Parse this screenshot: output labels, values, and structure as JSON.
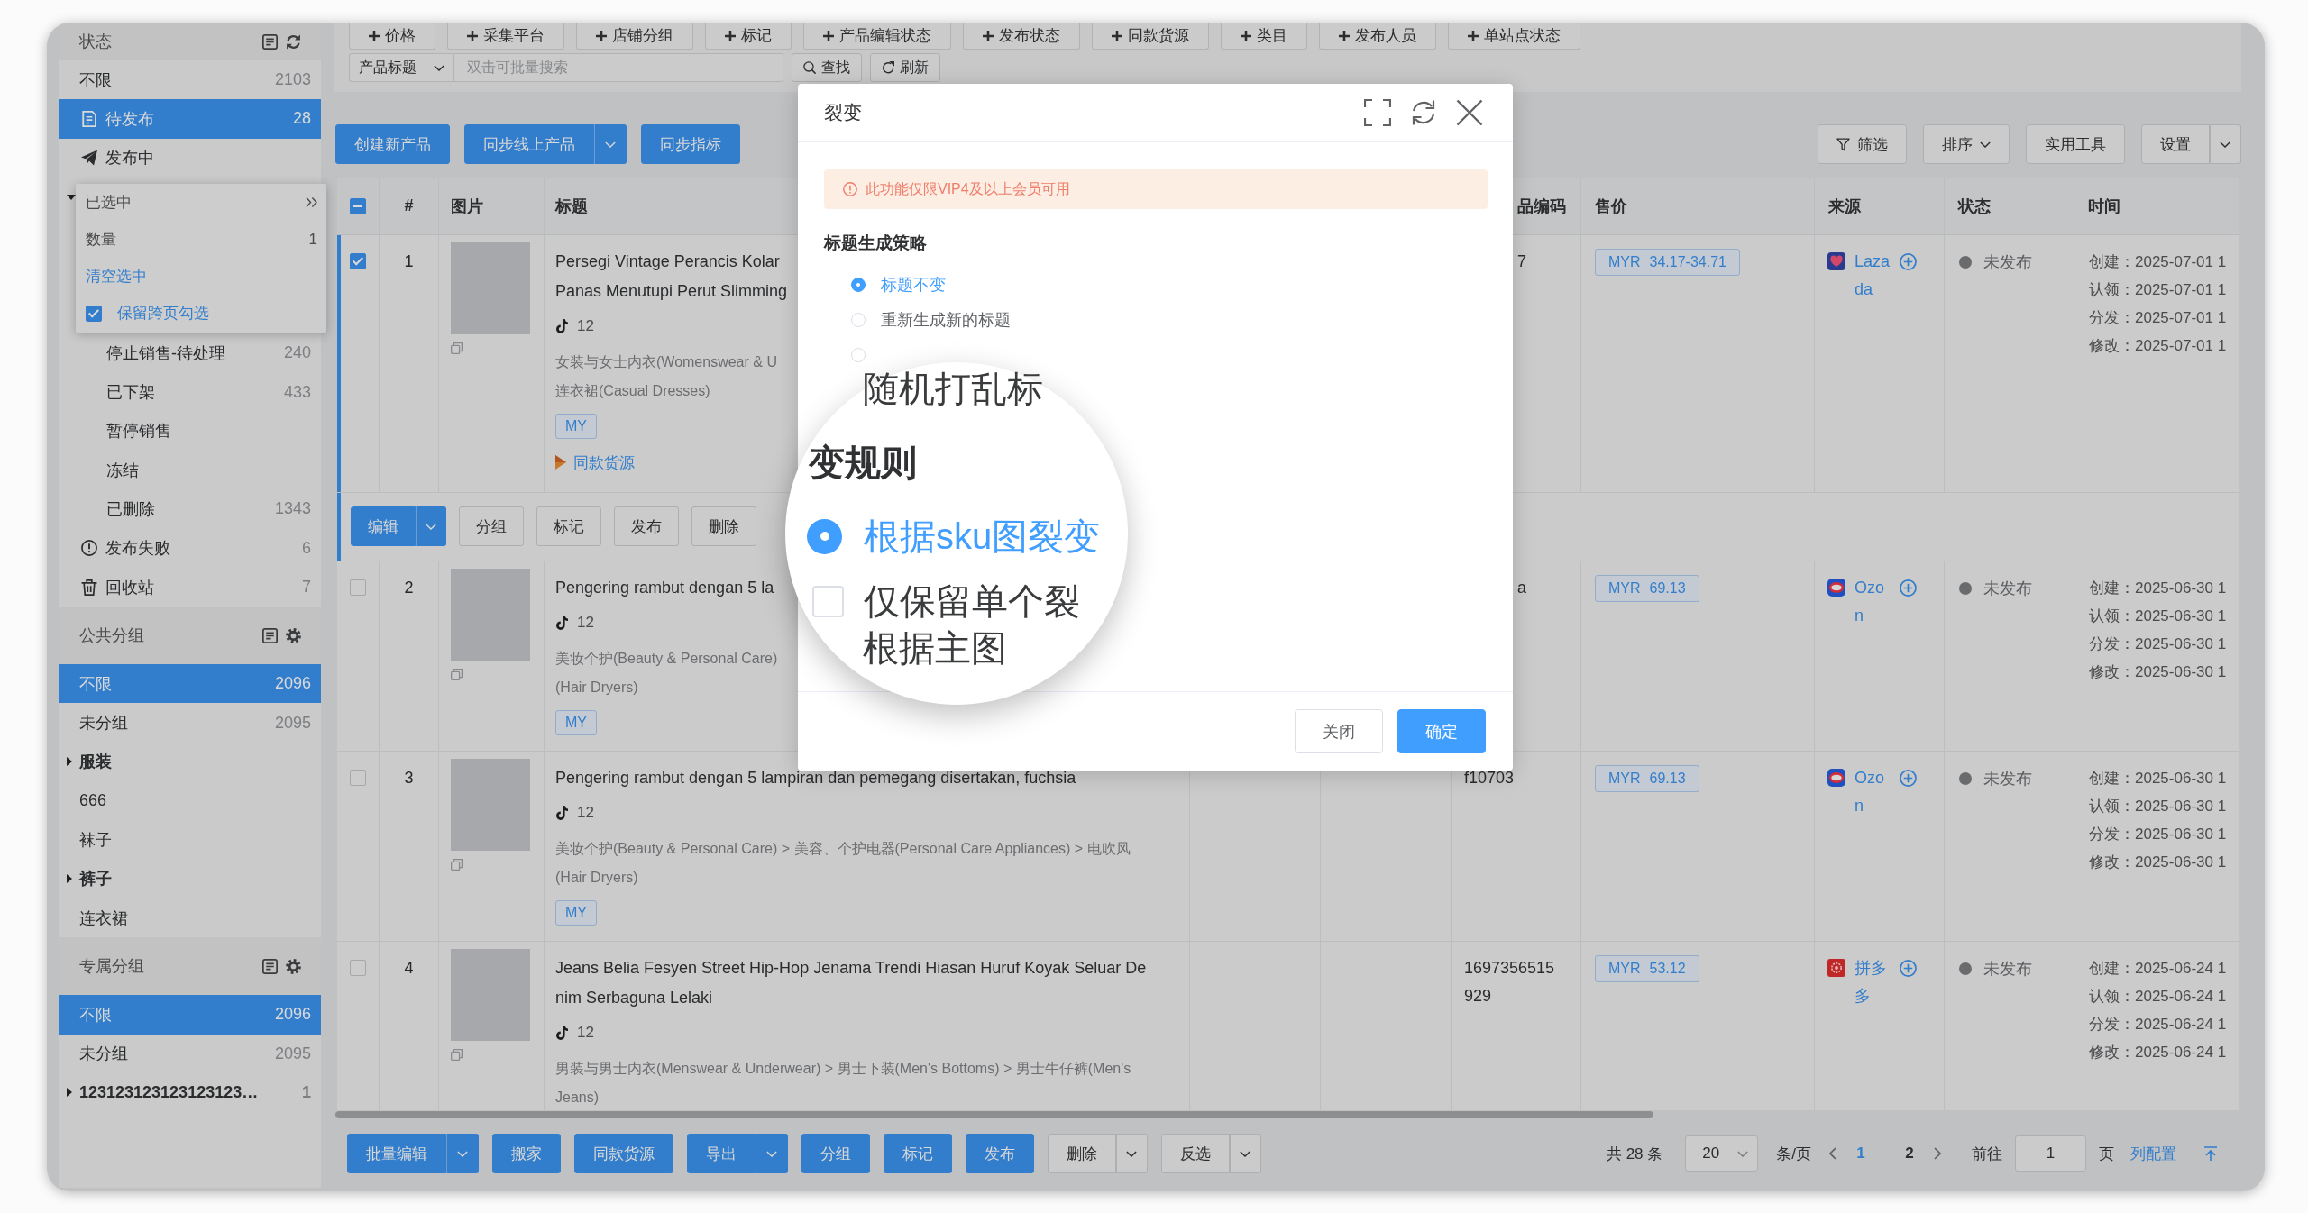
{
  "filters": {
    "tags": [
      "价格",
      "采集平台",
      "店铺分组",
      "标记",
      "产品编辑状态",
      "发布状态",
      "同款货源",
      "类目",
      "发布人员",
      "单站点状态"
    ],
    "search": {
      "field": "产品标题",
      "placeholder": "双击可批量搜索",
      "buttons": [
        {
          "label": "查找",
          "kind": "search"
        },
        {
          "label": "刷新",
          "kind": "refresh"
        }
      ]
    }
  },
  "sidebar": {
    "sections": [
      {
        "title": "状态",
        "kind": "status",
        "items": [
          {
            "label": "不限",
            "count": "2103",
            "selected": false,
            "kind": "plain"
          },
          {
            "label": "待发布",
            "count": "28",
            "selected": true,
            "kind": "draft"
          },
          {
            "label": "发布中",
            "selected": false,
            "kind": "sending"
          },
          {
            "kind": "group",
            "expanded": true,
            "children": [
              {
                "label": "停止销售-待处理",
                "count": "240",
                "selected": false,
                "kind": "plain"
              },
              {
                "label": "已下架",
                "count": "433",
                "selected": false,
                "kind": "plain"
              },
              {
                "label": "暂停销售",
                "selected": false,
                "kind": "plain"
              },
              {
                "label": "冻结",
                "selected": false,
                "kind": "plain"
              },
              {
                "label": "已删除",
                "count": "1343",
                "selected": false,
                "kind": "plain"
              }
            ]
          },
          {
            "label": "发布失败",
            "count": "6",
            "selected": false,
            "kind": "failed"
          },
          {
            "label": "回收站",
            "count": "7",
            "selected": false,
            "kind": "trash"
          }
        ]
      },
      {
        "title": "公共分组",
        "kind": "groups",
        "items": [
          {
            "label": "不限",
            "count": "2096",
            "selected": true,
            "kind": "plain"
          },
          {
            "label": "未分组",
            "count": "2095",
            "selected": false,
            "kind": "plain"
          },
          {
            "label": "服装",
            "selected": false,
            "kind": "folder",
            "expanded": false
          },
          {
            "label": "666",
            "selected": false,
            "kind": "plain"
          },
          {
            "label": "袜子",
            "selected": false,
            "kind": "plain"
          },
          {
            "label": "裤子",
            "selected": false,
            "kind": "folder",
            "expanded": false
          },
          {
            "label": "连衣裙",
            "selected": false,
            "kind": "plain"
          }
        ]
      },
      {
        "title": "专属分组",
        "kind": "groups",
        "items": [
          {
            "label": "不限",
            "count": "2096",
            "selected": true,
            "kind": "plain"
          },
          {
            "label": "未分组",
            "count": "2095",
            "selected": false,
            "kind": "plain"
          },
          {
            "label": "123123123123123123…",
            "count": "1",
            "selected": false,
            "kind": "folder",
            "expanded": false
          }
        ]
      }
    ],
    "selection": {
      "title": "已选中",
      "count_label": "数量",
      "count": "1",
      "clear": "清空选中",
      "keep_label": "保留跨页勾选",
      "keep_checked": true
    }
  },
  "toolbar": {
    "left": [
      {
        "label": "创建新产品",
        "kind": "plain"
      },
      {
        "label": "同步线上产品",
        "kind": "split"
      },
      {
        "label": "同步指标",
        "kind": "plain"
      }
    ],
    "right": [
      {
        "label": "筛选",
        "kind": "filter"
      },
      {
        "label": "排序",
        "kind": "menu"
      },
      {
        "label": "实用工具",
        "kind": "plain"
      },
      {
        "label": "设置",
        "kind": "split"
      }
    ]
  },
  "table": {
    "select_all": {
      "indeterminate": true
    },
    "columns": [
      {
        "label": "#"
      },
      {
        "label": "图片"
      },
      {
        "label": "标题"
      },
      {
        "label": "品编码",
        "covered": true
      },
      {
        "label": "售价"
      },
      {
        "label": "来源"
      },
      {
        "label": "状态"
      },
      {
        "label": "时间"
      }
    ],
    "rows": [
      {
        "checked": true,
        "index": "1",
        "title": [
          "Persegi Vintage Perancis Kolar",
          "Panas Menutupi Perut Slimming"
        ],
        "count": "12",
        "category": [
          "女装与女士内衣(Womenswear & U",
          "连衣裙(Casual Dresses)"
        ],
        "tag": "MY",
        "link": "同款货源",
        "code": {
          "text": "7",
          "covered": true
        },
        "price": {
          "currency": "MYR",
          "amount": "34.17-34.71"
        },
        "source": {
          "kind": "heart",
          "name": "Lazada"
        },
        "status": "未发布",
        "times": [
          "创建：2025-07-01 1",
          "认领：2025-07-01 1",
          "分发：2025-07-01 1",
          "修改：2025-07-01 1"
        ],
        "actions": [
          {
            "label": "编辑",
            "kind": "split",
            "primary": true
          },
          {
            "label": "分组",
            "kind": "plain",
            "primary": false
          },
          {
            "label": "标记",
            "kind": "plain",
            "primary": false
          },
          {
            "label": "发布",
            "kind": "plain",
            "primary": false
          },
          {
            "label": "删除",
            "kind": "plain",
            "primary": false
          }
        ]
      },
      {
        "checked": false,
        "index": "2",
        "title": [
          "Pengering rambut dengan 5 la"
        ],
        "count": "12",
        "category": [
          "美妆个护(Beauty & Personal Care)",
          "(Hair Dryers)"
        ],
        "tag": "MY",
        "code": {
          "text": "a",
          "covered": true
        },
        "price": {
          "currency": "MYR",
          "amount": "69.13"
        },
        "source": {
          "kind": "ring",
          "name": "Ozon"
        },
        "status": "未发布",
        "times": [
          "创建：2025-06-30 1",
          "认领：2025-06-30 1",
          "分发：2025-06-30 1",
          "修改：2025-06-30 1"
        ]
      },
      {
        "checked": false,
        "index": "3",
        "title": [
          "Pengering rambut dengan 5 lampiran dan pemegang disertakan, fuchsia"
        ],
        "count": "12",
        "category": [
          "美妆个护(Beauty & Personal Care) > 美容、个护电器(Personal Care Appliances) > 电吹风",
          "(Hair Dryers)"
        ],
        "tag": "MY",
        "code": {
          "text": "f10703"
        },
        "price": {
          "currency": "MYR",
          "amount": "69.13"
        },
        "source": {
          "kind": "ring",
          "name": "Ozon"
        },
        "status": "未发布",
        "times": [
          "创建：2025-06-30 1",
          "认领：2025-06-30 1",
          "分发：2025-06-30 1",
          "修改：2025-06-30 1"
        ]
      },
      {
        "checked": false,
        "index": "4",
        "title": [
          "Jeans Belia Fesyen Street Hip-Hop Jenama Trendi Hiasan Huruf Koyak Seluar De",
          "nim Serbaguna Lelaki"
        ],
        "count": "12",
        "category": [
          "男装与男士内衣(Menswear & Underwear) > 男士下装(Men's Bottoms) > 男士牛仔裤(Men's",
          "Jeans)"
        ],
        "code": {
          "text": "1697356515929"
        },
        "price": {
          "currency": "MYR",
          "amount": "53.12"
        },
        "source": {
          "kind": "flower",
          "name": "拼多多"
        },
        "status": "未发布",
        "times": [
          "创建：2025-06-24 1",
          "认领：2025-06-24 1",
          "分发：2025-06-24 1",
          "修改：2025-06-24 1"
        ]
      }
    ]
  },
  "bottom_bar": {
    "buttons": [
      {
        "label": "批量编辑",
        "kind": "split",
        "primary": true
      },
      {
        "label": "搬家",
        "kind": "plain",
        "primary": true
      },
      {
        "label": "同款货源",
        "kind": "plain",
        "primary": true
      },
      {
        "label": "导出",
        "kind": "split",
        "primary": true
      },
      {
        "label": "分组",
        "kind": "plain",
        "primary": true
      },
      {
        "label": "标记",
        "kind": "plain",
        "primary": true
      },
      {
        "label": "发布",
        "kind": "plain",
        "primary": true
      },
      {
        "label": "删除",
        "kind": "split",
        "primary": false
      },
      {
        "label": "反选",
        "kind": "split",
        "primary": false
      }
    ],
    "pagination": {
      "total": "共 28 条",
      "page_size": "20",
      "per_page": "条/页",
      "pages": [
        {
          "label": "1",
          "selected": true
        },
        {
          "label": "2",
          "selected": false
        }
      ],
      "goto": "前往",
      "goto_value": "1",
      "page_unit": "页",
      "columns_link": "列配置"
    }
  },
  "dialog": {
    "title": "裂变",
    "notice": "此功能仅限VIP4及以上会员可用",
    "section": "标题生成策略",
    "options": [
      {
        "label": "标题不变",
        "selected": true
      },
      {
        "label": "重新生成新的标题",
        "selected": false
      },
      {
        "selected": false
      }
    ],
    "buttons": [
      {
        "label": "关闭",
        "primary": false
      },
      {
        "label": "确定",
        "primary": true
      }
    ]
  },
  "magnifier": {
    "items": [
      {
        "kind": "text",
        "text": "随机打乱标"
      },
      {
        "kind": "heading",
        "text": "变规则"
      },
      {
        "kind": "radio",
        "label": "根据sku图裂变",
        "selected": true
      },
      {
        "kind": "checkbox",
        "label": "仅保留单个裂",
        "checked": false
      },
      {
        "kind": "text",
        "text": "根据主图"
      }
    ]
  }
}
